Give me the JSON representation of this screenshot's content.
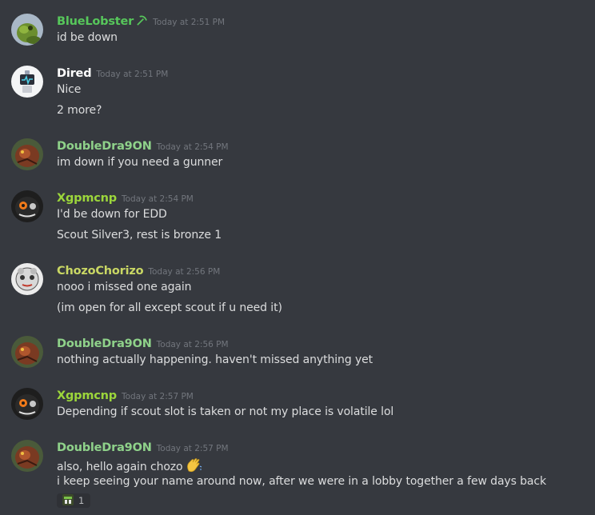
{
  "messages": [
    {
      "author": "BlueLobster",
      "author_color": "#57c75b",
      "timestamp": "Today at 2:51 PM",
      "lines": [
        "id be down"
      ]
    },
    {
      "author": "Dired",
      "author_color": "#ffffff",
      "timestamp": "Today at 2:51 PM",
      "lines": [
        "Nice",
        "2 more?"
      ]
    },
    {
      "author": "DoubleDra9ON",
      "author_color": "#8fd28a",
      "timestamp": "Today at 2:54 PM",
      "lines": [
        "im down if you need a gunner"
      ]
    },
    {
      "author": "Xgpmcnp",
      "author_color": "#9cd63b",
      "timestamp": "Today at 2:54 PM",
      "lines": [
        "I'd be down for EDD",
        "Scout Silver3, rest is bronze 1"
      ]
    },
    {
      "author": "ChozoChorizo",
      "author_color": "#c9d764",
      "timestamp": "Today at 2:56 PM",
      "lines": [
        "nooo i missed one again",
        "(im open for all except scout if u need it)"
      ]
    },
    {
      "author": "DoubleDra9ON",
      "author_color": "#8fd28a",
      "timestamp": "Today at 2:56 PM",
      "lines": [
        "nothing actually happening. haven't missed anything yet"
      ]
    },
    {
      "author": "Xgpmcnp",
      "author_color": "#9cd63b",
      "timestamp": "Today at 2:57 PM",
      "lines": [
        "Depending if scout slot is taken or not my place is volatile lol"
      ]
    },
    {
      "author": "DoubleDra9ON",
      "author_color": "#8fd28a",
      "timestamp": "Today at 2:57 PM",
      "lines": [
        "also, hello again chozo",
        "i keep seeing your name around now, after we were in a lobby together a few days back"
      ]
    }
  ],
  "icons": {
    "badge": "pickaxe-icon",
    "wave": "waving-hand-emoji",
    "reaction": "custom-emoji"
  },
  "reaction": {
    "count": "1"
  },
  "colors": {
    "background": "#36393f",
    "text": "#dcddde",
    "timestamp": "#72767d",
    "reaction_bg": "#2f3136"
  }
}
